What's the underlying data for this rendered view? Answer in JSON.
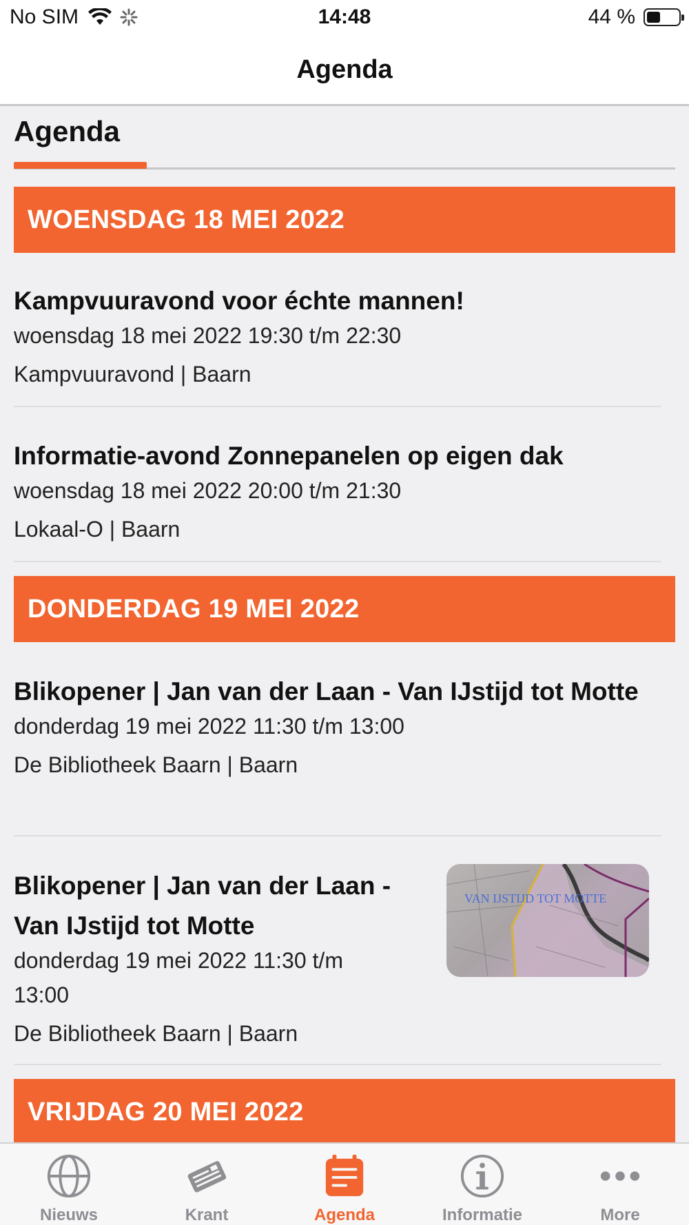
{
  "status_bar": {
    "carrier": "No SIM",
    "time": "14:48",
    "battery": "44 %",
    "battery_level": 0.44
  },
  "nav": {
    "title": "Agenda"
  },
  "page": {
    "heading": "Agenda"
  },
  "days": [
    {
      "label": "WOENSDAG 18 MEI 2022"
    },
    {
      "label": "DONDERDAG 19 MEI 2022"
    },
    {
      "label": "VRIJDAG 20 MEI 2022"
    }
  ],
  "events": [
    {
      "title": "Kampvuuravond voor échte mannen!",
      "date": "woensdag 18 mei 2022 19:30 t/m 22:30",
      "location": "Kampvuuravond | Baarn"
    },
    {
      "title": "Informatie-avond Zonnepanelen op eigen dak",
      "date": "woensdag 18 mei 2022 20:00 t/m 21:30",
      "location": "Lokaal-O | Baarn"
    },
    {
      "title": "Blikopener | Jan van der Laan - Van IJstijd tot Motte",
      "date": "donderdag 19 mei 2022 11:30 t/m 13:00",
      "location": "De Bibliotheek Baarn | Baarn"
    },
    {
      "title": "Blikopener | Jan van der Laan - Van IJstijd tot Motte",
      "date": "donderdag 19 mei 2022 11:30 t/m 13:00",
      "location": "De Bibliotheek Baarn | Baarn",
      "thumbnail_text": "VAN IJSTIJD TOT MOTTE"
    }
  ],
  "tabs": [
    {
      "label": "Nieuws",
      "icon": "globe-icon",
      "active": false
    },
    {
      "label": "Krant",
      "icon": "newspaper-icon",
      "active": false
    },
    {
      "label": "Agenda",
      "icon": "calendar-icon",
      "active": true
    },
    {
      "label": "Informatie",
      "icon": "info-icon",
      "active": false
    },
    {
      "label": "More",
      "icon": "more-icon",
      "active": false
    }
  ],
  "colors": {
    "accent": "#f26530",
    "inactive_tab": "#8e8e93",
    "background": "#f0f0f2"
  }
}
